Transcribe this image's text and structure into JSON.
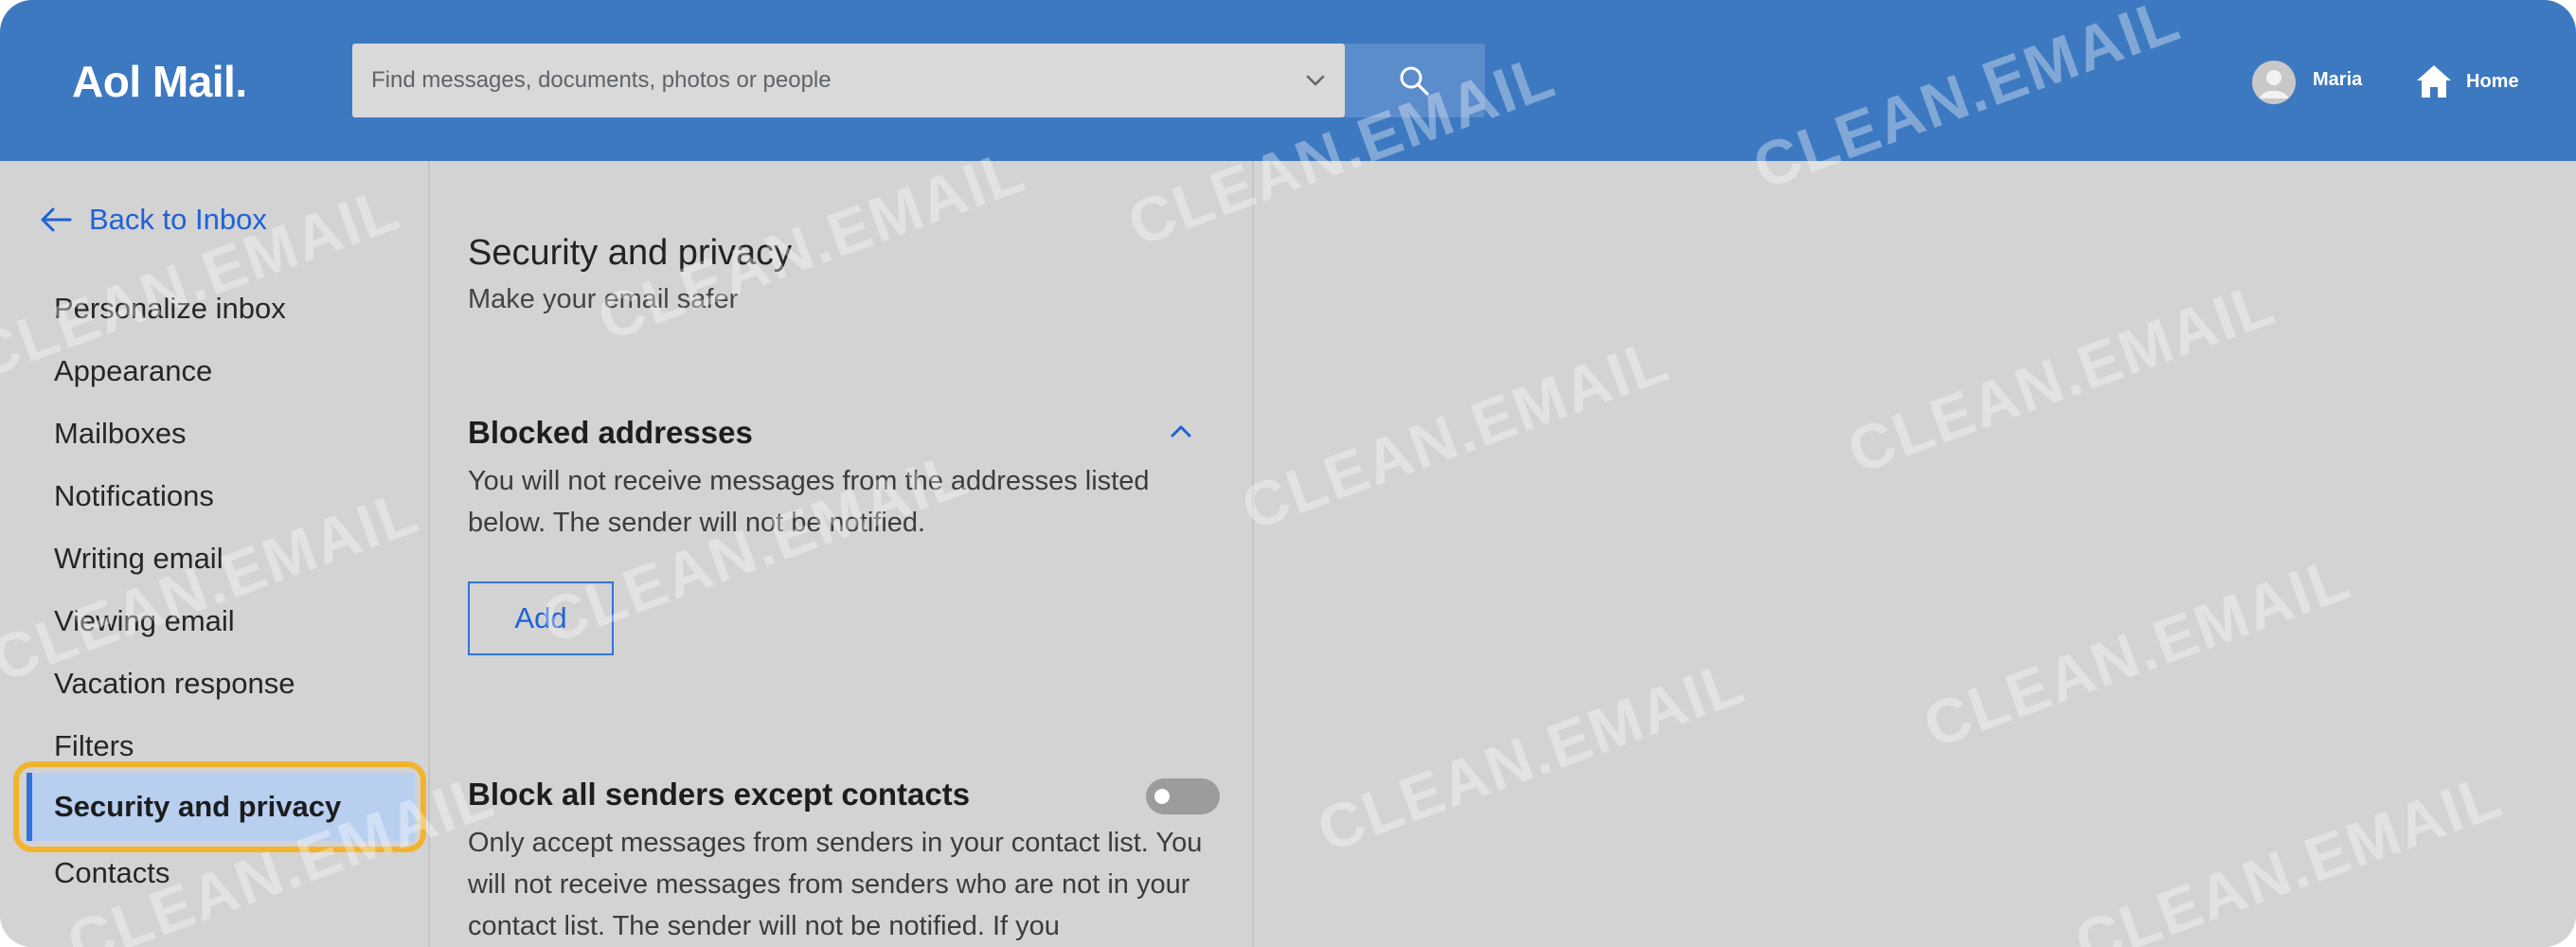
{
  "app": {
    "logo_text": "Aol Mail."
  },
  "search": {
    "placeholder": "Find messages, documents, photos or people",
    "chevron_icon": "chevron-down-icon",
    "search_icon": "magnifier-icon"
  },
  "header": {
    "user_name": "Maria",
    "home_label": "Home"
  },
  "sidebar": {
    "back_label": "Back to Inbox",
    "items": [
      {
        "label": "Personalize inbox"
      },
      {
        "label": "Appearance"
      },
      {
        "label": "Mailboxes"
      },
      {
        "label": "Notifications"
      },
      {
        "label": "Writing email"
      },
      {
        "label": "Viewing email"
      },
      {
        "label": "Vacation response"
      },
      {
        "label": "Filters"
      },
      {
        "label": "Security and privacy",
        "active": true
      },
      {
        "label": "Contacts"
      }
    ]
  },
  "settings": {
    "title": "Security and privacy",
    "subtitle": "Make your email safer",
    "blocked": {
      "title": "Blocked addresses",
      "description": "You will not receive messages from the addresses listed below. The sender will not be notified.",
      "add_label": "Add"
    },
    "block_all": {
      "title": "Block all senders except contacts",
      "description": "Only accept messages from senders in your contact list. You will not receive messages from senders who are not in your contact list. The sender will not be notified. If you",
      "enabled": false
    }
  },
  "watermark": {
    "text": "CLEAN.EMAIL"
  },
  "colors": {
    "header_bg": "#3d79c0",
    "link_blue": "#1f62d6",
    "highlight_orange": "#f2b32d",
    "active_bg": "#b9cff0"
  }
}
